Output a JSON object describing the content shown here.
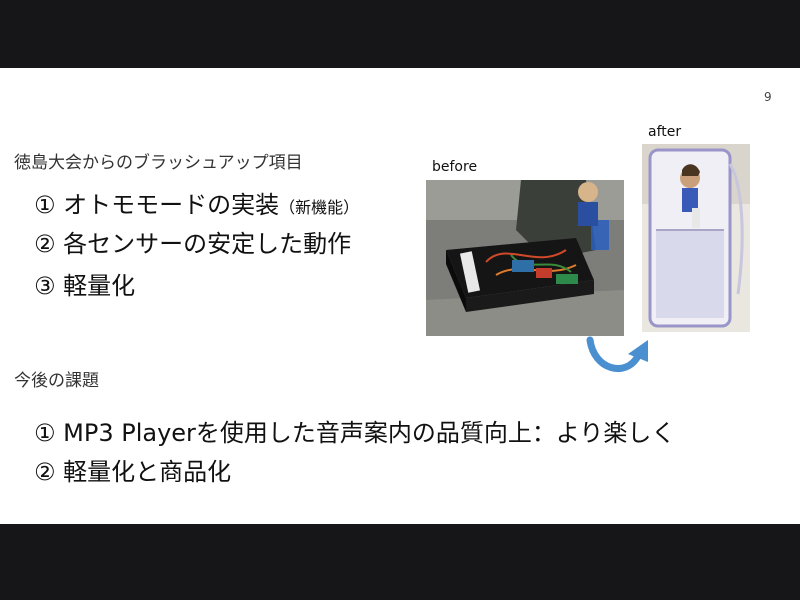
{
  "slide": {
    "page_number": "9",
    "section1": {
      "heading": "徳島大会からのブラッシュアップ項目",
      "items": [
        {
          "text": "① オトモモードの実装",
          "note": "（新機能）"
        },
        {
          "text": "② 各センサーの安定した動作"
        },
        {
          "text": "③ 軽量化"
        }
      ]
    },
    "section2": {
      "heading": "今後の課題",
      "items": [
        {
          "text": "① MP3 Playerを使用した音声案内の品質向上：より楽しく"
        },
        {
          "text": "② 軽量化と商品化"
        }
      ]
    },
    "photos": {
      "before_label": "before",
      "after_label": "after"
    }
  },
  "colors": {
    "letterbox": "#161618",
    "slide_bg": "#ffffff",
    "arrow": "#4a8fd0"
  }
}
